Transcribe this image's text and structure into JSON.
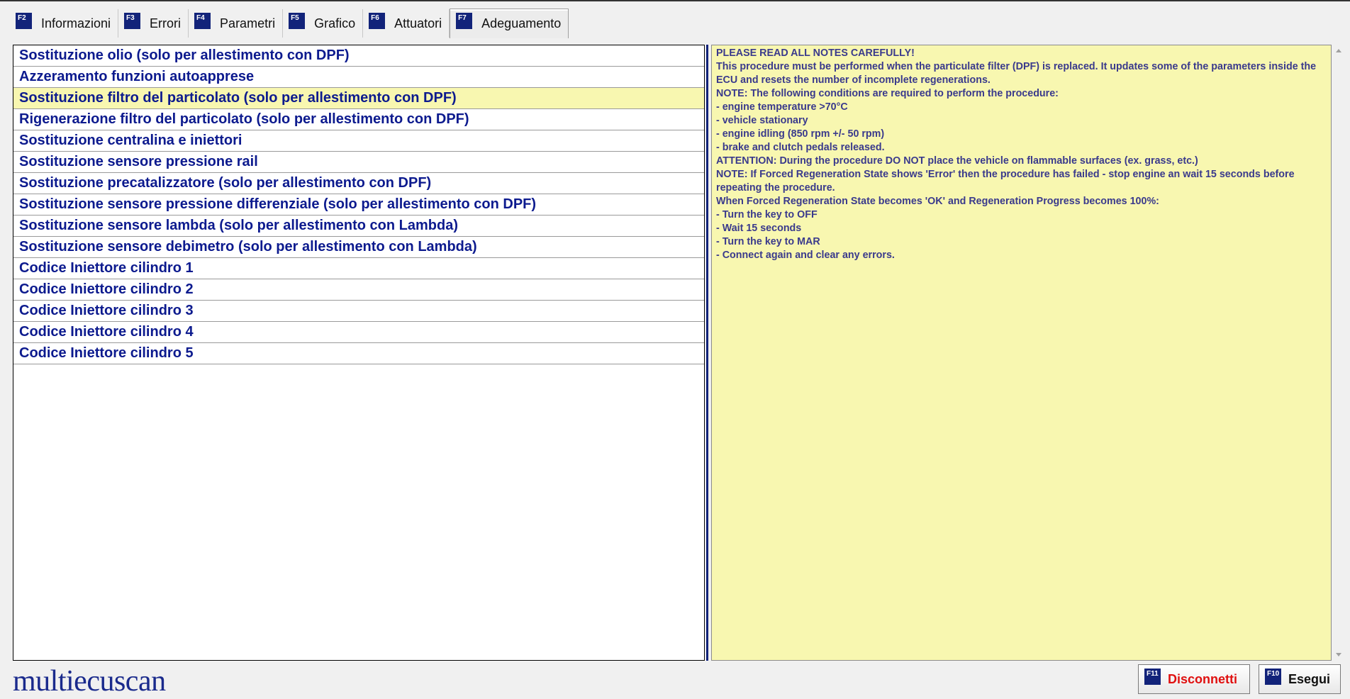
{
  "tabs": [
    {
      "key": "F2",
      "label": "Informazioni"
    },
    {
      "key": "F3",
      "label": "Errori"
    },
    {
      "key": "F4",
      "label": "Parametri"
    },
    {
      "key": "F5",
      "label": "Grafico"
    },
    {
      "key": "F6",
      "label": "Attuatori"
    },
    {
      "key": "F7",
      "label": "Adeguamento"
    }
  ],
  "active_tab": "Adeguamento",
  "procedures": [
    "Sostituzione olio (solo per allestimento con DPF)",
    "Azzeramento funzioni autoapprese",
    "Sostituzione filtro del particolato (solo per allestimento con DPF)",
    "Rigenerazione filtro del particolato (solo per allestimento con DPF)",
    "Sostituzione centralina e iniettori",
    "Sostituzione sensore pressione rail",
    "Sostituzione precatalizzatore (solo per allestimento con DPF)",
    "Sostituzione sensore pressione differenziale (solo per allestimento con DPF)",
    "Sostituzione sensore lambda (solo per allestimento con Lambda)",
    "Sostituzione sensore debimetro (solo per allestimento con Lambda)",
    "Codice Iniettore cilindro 1",
    "Codice Iniettore cilindro 2",
    "Codice Iniettore cilindro 3",
    "Codice Iniettore cilindro 4",
    "Codice Iniettore cilindro 5"
  ],
  "selected_procedure": "Sostituzione filtro del particolato (solo per allestimento con DPF)",
  "notes": [
    "PLEASE READ ALL NOTES CAREFULLY!",
    "This procedure must be performed when the particulate filter (DPF) is replaced. It updates some of the parameters inside the ECU and resets the number of incomplete regenerations.",
    "NOTE: The following conditions are required to perform the procedure:",
    "- engine temperature >70°C",
    "- vehicle stationary",
    "- engine idling (850 rpm +/- 50 rpm)",
    "- brake and clutch pedals released.",
    "ATTENTION: During the procedure DO NOT place the vehicle on flammable surfaces (ex. grass, etc.)",
    "NOTE: If Forced Regeneration State shows 'Error' then the procedure has failed - stop engine an wait 15 seconds before repeating the procedure.",
    "When Forced Regeneration State becomes 'OK' and Regeneration Progress becomes 100%:",
    "- Turn the key to OFF",
    "- Wait 15 seconds",
    "- Turn the key to MAR",
    "- Connect again and clear any errors."
  ],
  "footer": {
    "logo": "multiecuscan",
    "disconnect": {
      "key": "F11",
      "label": "Disconnetti"
    },
    "run": {
      "key": "F10",
      "label": "Esegui"
    }
  },
  "colors": {
    "accent": "#12237a",
    "list_text": "#0c1a8e",
    "highlight": "#f8f7b0",
    "disconnect_text": "#e01010"
  }
}
